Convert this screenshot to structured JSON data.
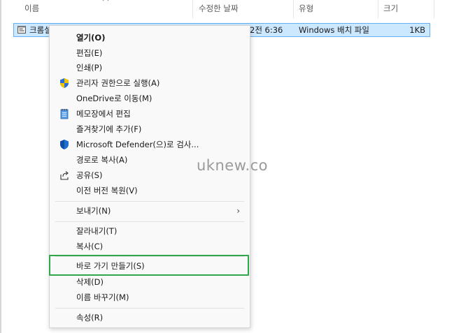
{
  "columns": {
    "name": "이름",
    "modified": "수정한 날짜",
    "type": "유형",
    "size": "크기"
  },
  "file": {
    "name": "크롬설",
    "date": "2전 6:36",
    "type": "Windows 배치 파일",
    "size": "1KB",
    "icon": "batch-file-icon"
  },
  "menu": {
    "items": [
      {
        "label": "열기(O)",
        "icon": null
      },
      {
        "label": "편집(E)",
        "icon": null
      },
      {
        "label": "인쇄(P)",
        "icon": null
      },
      {
        "label": "관리자 권한으로 실행(A)",
        "icon": "uac-shield-icon"
      },
      {
        "label": "OneDrive로 이동(M)",
        "icon": null
      },
      {
        "label": "메모장에서 편집",
        "icon": "notepad-icon"
      },
      {
        "label": "즐겨찾기에 추가(F)",
        "icon": null
      },
      {
        "label": "Microsoft Defender(으)로 검사...",
        "icon": "defender-shield-icon"
      },
      {
        "label": "경로로 복사(A)",
        "icon": null
      },
      {
        "label": "공유(S)",
        "icon": "share-icon"
      },
      {
        "label": "이전 버전 복원(V)",
        "icon": null
      },
      {
        "label": "보내기(N)",
        "icon": null
      },
      {
        "label": "잘라내기(T)",
        "icon": null
      },
      {
        "label": "복사(C)",
        "icon": null
      },
      {
        "label": "바로 가기 만들기(S)",
        "icon": null
      },
      {
        "label": "삭제(D)",
        "icon": null
      },
      {
        "label": "이름 바꾸기(M)",
        "icon": null
      },
      {
        "label": "속성(R)",
        "icon": null
      }
    ]
  },
  "watermark": "uknew.co",
  "colors": {
    "selection": "#cce8ff",
    "highlight": "#2ea84a"
  }
}
